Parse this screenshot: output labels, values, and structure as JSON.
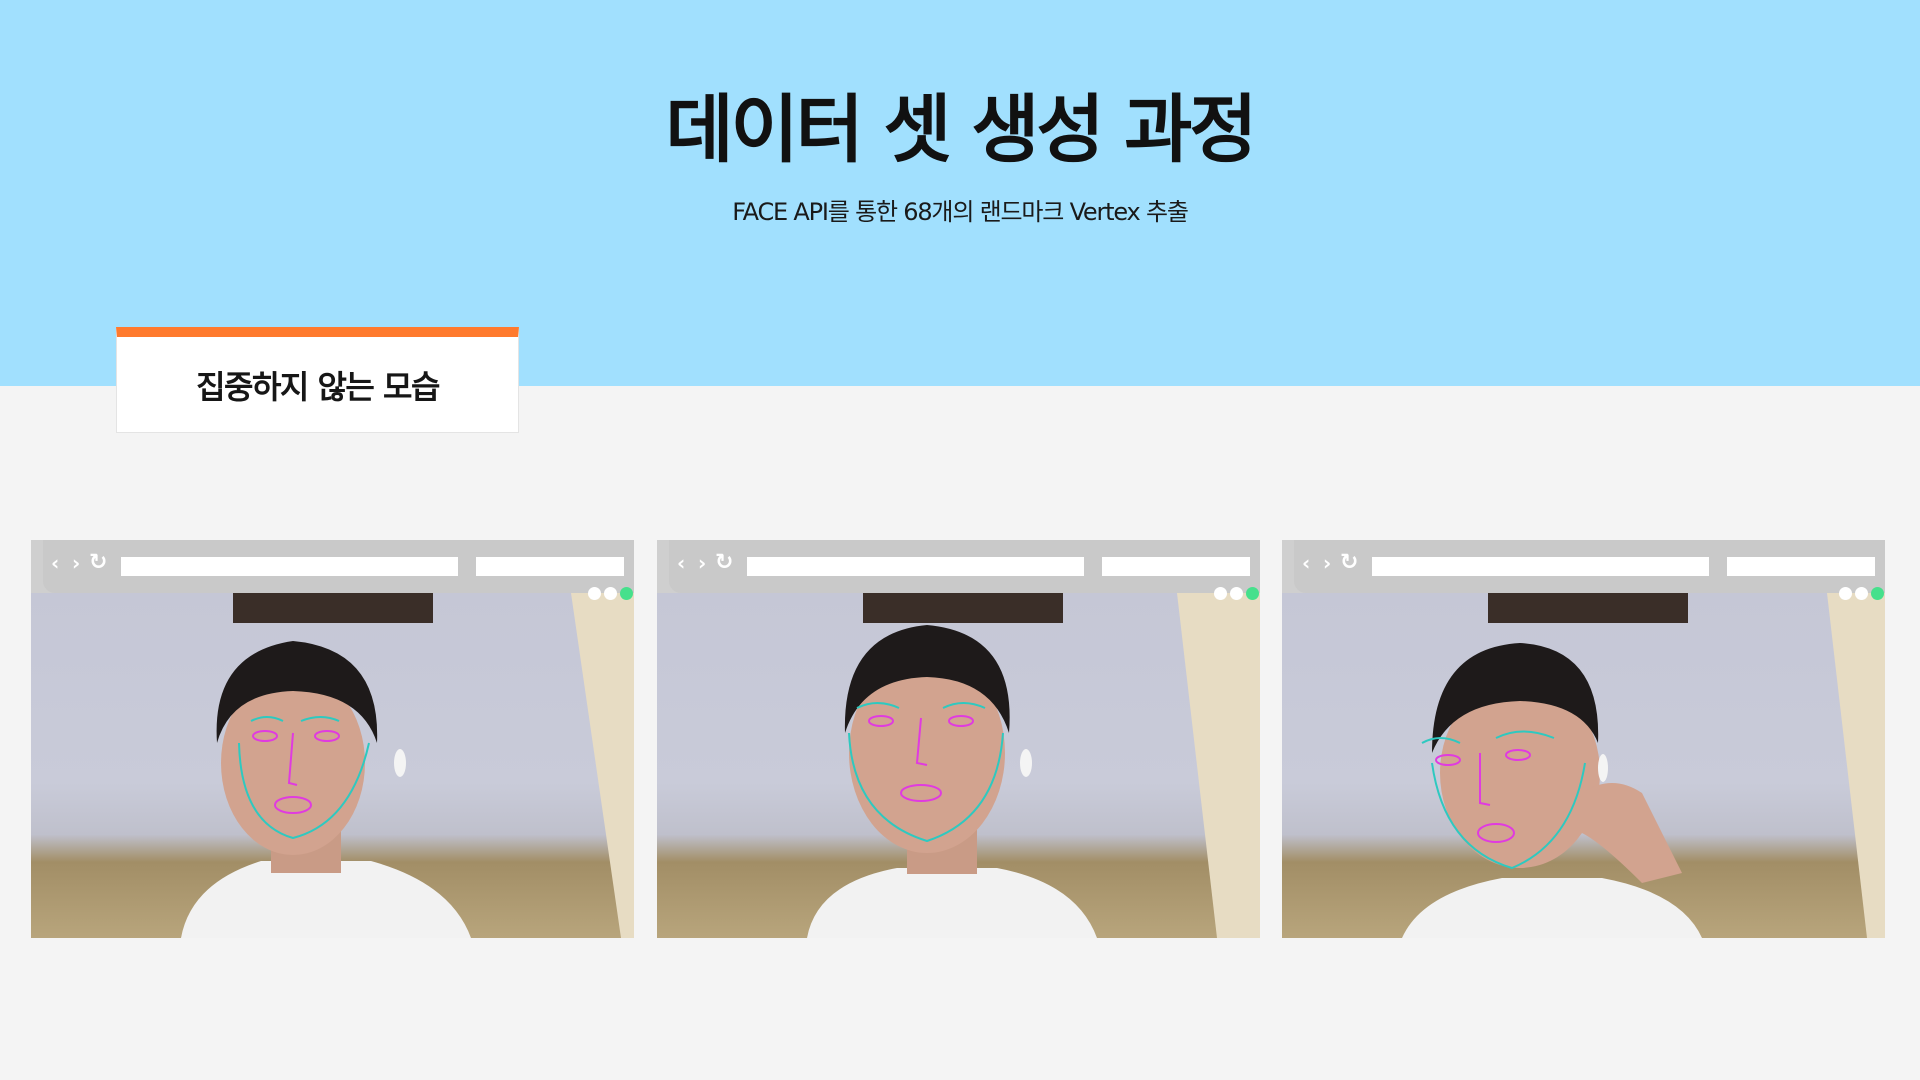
{
  "hero": {
    "title": "데이터 셋 생성 과정",
    "subtitle": "FACE API를 통한 68개의 랜드마크 Vertex 추출",
    "background_color": "#a1e0fe"
  },
  "section": {
    "label": "집중하지 않는 모습",
    "accent_color": "#ff7a2e"
  },
  "browser_frames": [
    {
      "nav_icons": [
        "chevron-left-icon",
        "chevron-right-icon",
        "reload-icon"
      ],
      "window_dots": [
        "#ffffff",
        "#ffffff",
        "#46e08c"
      ]
    },
    {
      "nav_icons": [
        "chevron-left-icon",
        "chevron-right-icon",
        "reload-icon"
      ],
      "window_dots": [
        "#ffffff",
        "#ffffff",
        "#46e08c"
      ]
    },
    {
      "nav_icons": [
        "chevron-left-icon",
        "chevron-right-icon",
        "reload-icon"
      ],
      "window_dots": [
        "#ffffff",
        "#ffffff",
        "#46e08c"
      ]
    }
  ],
  "landmark_colors": {
    "contour": "#2ec9c0",
    "points": "#e03be0"
  }
}
